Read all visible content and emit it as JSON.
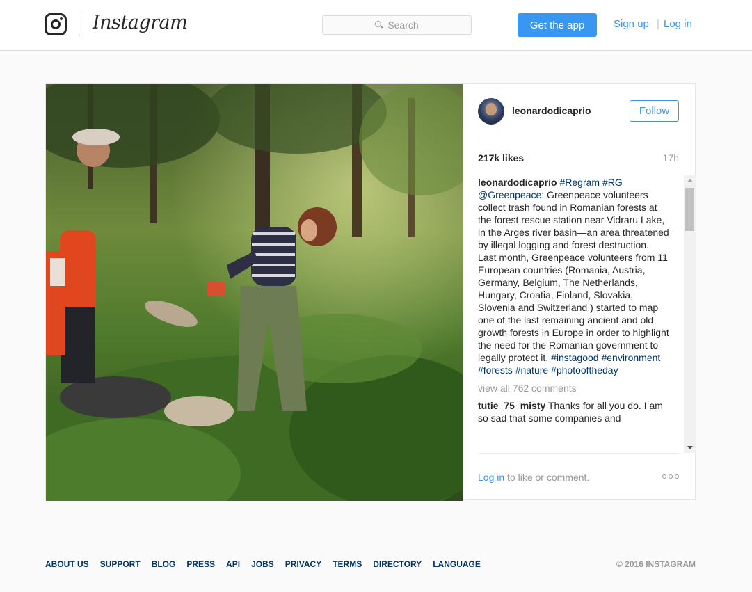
{
  "header": {
    "wordmark": "Instagram",
    "search_placeholder": "Search",
    "get_app": "Get the app",
    "sign_up": "Sign up",
    "separator": "|",
    "log_in": "Log in"
  },
  "post": {
    "username": "leonardodicaprio",
    "follow": "Follow",
    "likes": "217k likes",
    "time": "17h",
    "caption": {
      "user": "leonardodicaprio",
      "tags_start": "#Regram #RG",
      "mention": "@Greenpeace",
      "body": ": Greenpeace volunteers collect trash found in Romanian forests at the forest rescue station near Vidraru Lake, in the Argeș river basin—an area threatened by illegal logging and forest destruction. Last month, Greenpeace volunteers from 11 European countries (Romania, Austria, Germany, Belgium, The Netherlands, Hungary, Croatia, Finland, Slovakia, Slovenia and Switzerland ) started to map one of the last remaining ancient and old growth forests in Europe in order to highlight the need for the Romanian government to legally protect it.",
      "tags_end": "#instagood #environment #forests #nature #photooftheday"
    },
    "view_all": "view all 762 comments",
    "comment": {
      "user": "tutie_75_misty",
      "text": "Thanks for all you do. I am so sad that some companies and"
    },
    "footer_link": "Log in",
    "footer_text": " to like or comment.",
    "photo_alt": "volunteers collecting trash in forest"
  },
  "footer": {
    "links": [
      "ABOUT US",
      "SUPPORT",
      "BLOG",
      "PRESS",
      "API",
      "JOBS",
      "PRIVACY",
      "TERMS",
      "DIRECTORY",
      "LANGUAGE"
    ],
    "copyright": "© 2016 INSTAGRAM"
  },
  "colors": {
    "accent": "#3897f0",
    "tag": "#003569",
    "muted": "#999999"
  }
}
